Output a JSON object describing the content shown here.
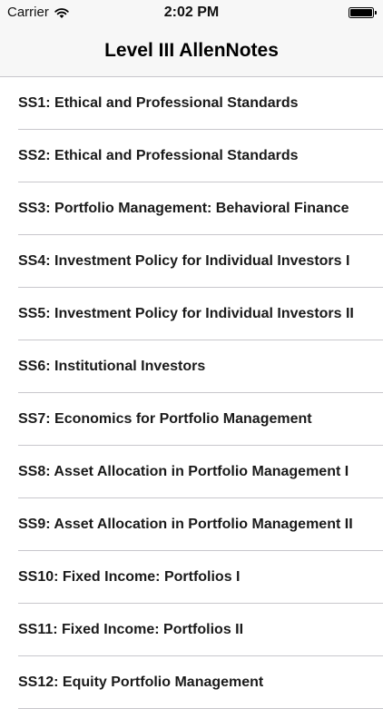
{
  "status_bar": {
    "carrier": "Carrier",
    "time": "2:02 PM",
    "wifi_icon": "wifi-icon",
    "battery_icon": "battery-icon"
  },
  "nav": {
    "title": "Level III AllenNotes"
  },
  "list": {
    "items": [
      {
        "label": "SS1: Ethical and Professional Standards"
      },
      {
        "label": "SS2: Ethical and Professional Standards"
      },
      {
        "label": "SS3: Portfolio Management: Behavioral Finance"
      },
      {
        "label": "SS4: Investment Policy for Individual Investors I"
      },
      {
        "label": "SS5: Investment Policy for Individual Investors II"
      },
      {
        "label": "SS6: Institutional Investors"
      },
      {
        "label": "SS7: Economics for Portfolio Management"
      },
      {
        "label": "SS8: Asset Allocation in Portfolio Management I"
      },
      {
        "label": "SS9: Asset Allocation in Portfolio Management II"
      },
      {
        "label": "SS10: Fixed Income: Portfolios I"
      },
      {
        "label": "SS11: Fixed Income: Portfolios II"
      },
      {
        "label": "SS12: Equity Portfolio Management"
      }
    ]
  }
}
